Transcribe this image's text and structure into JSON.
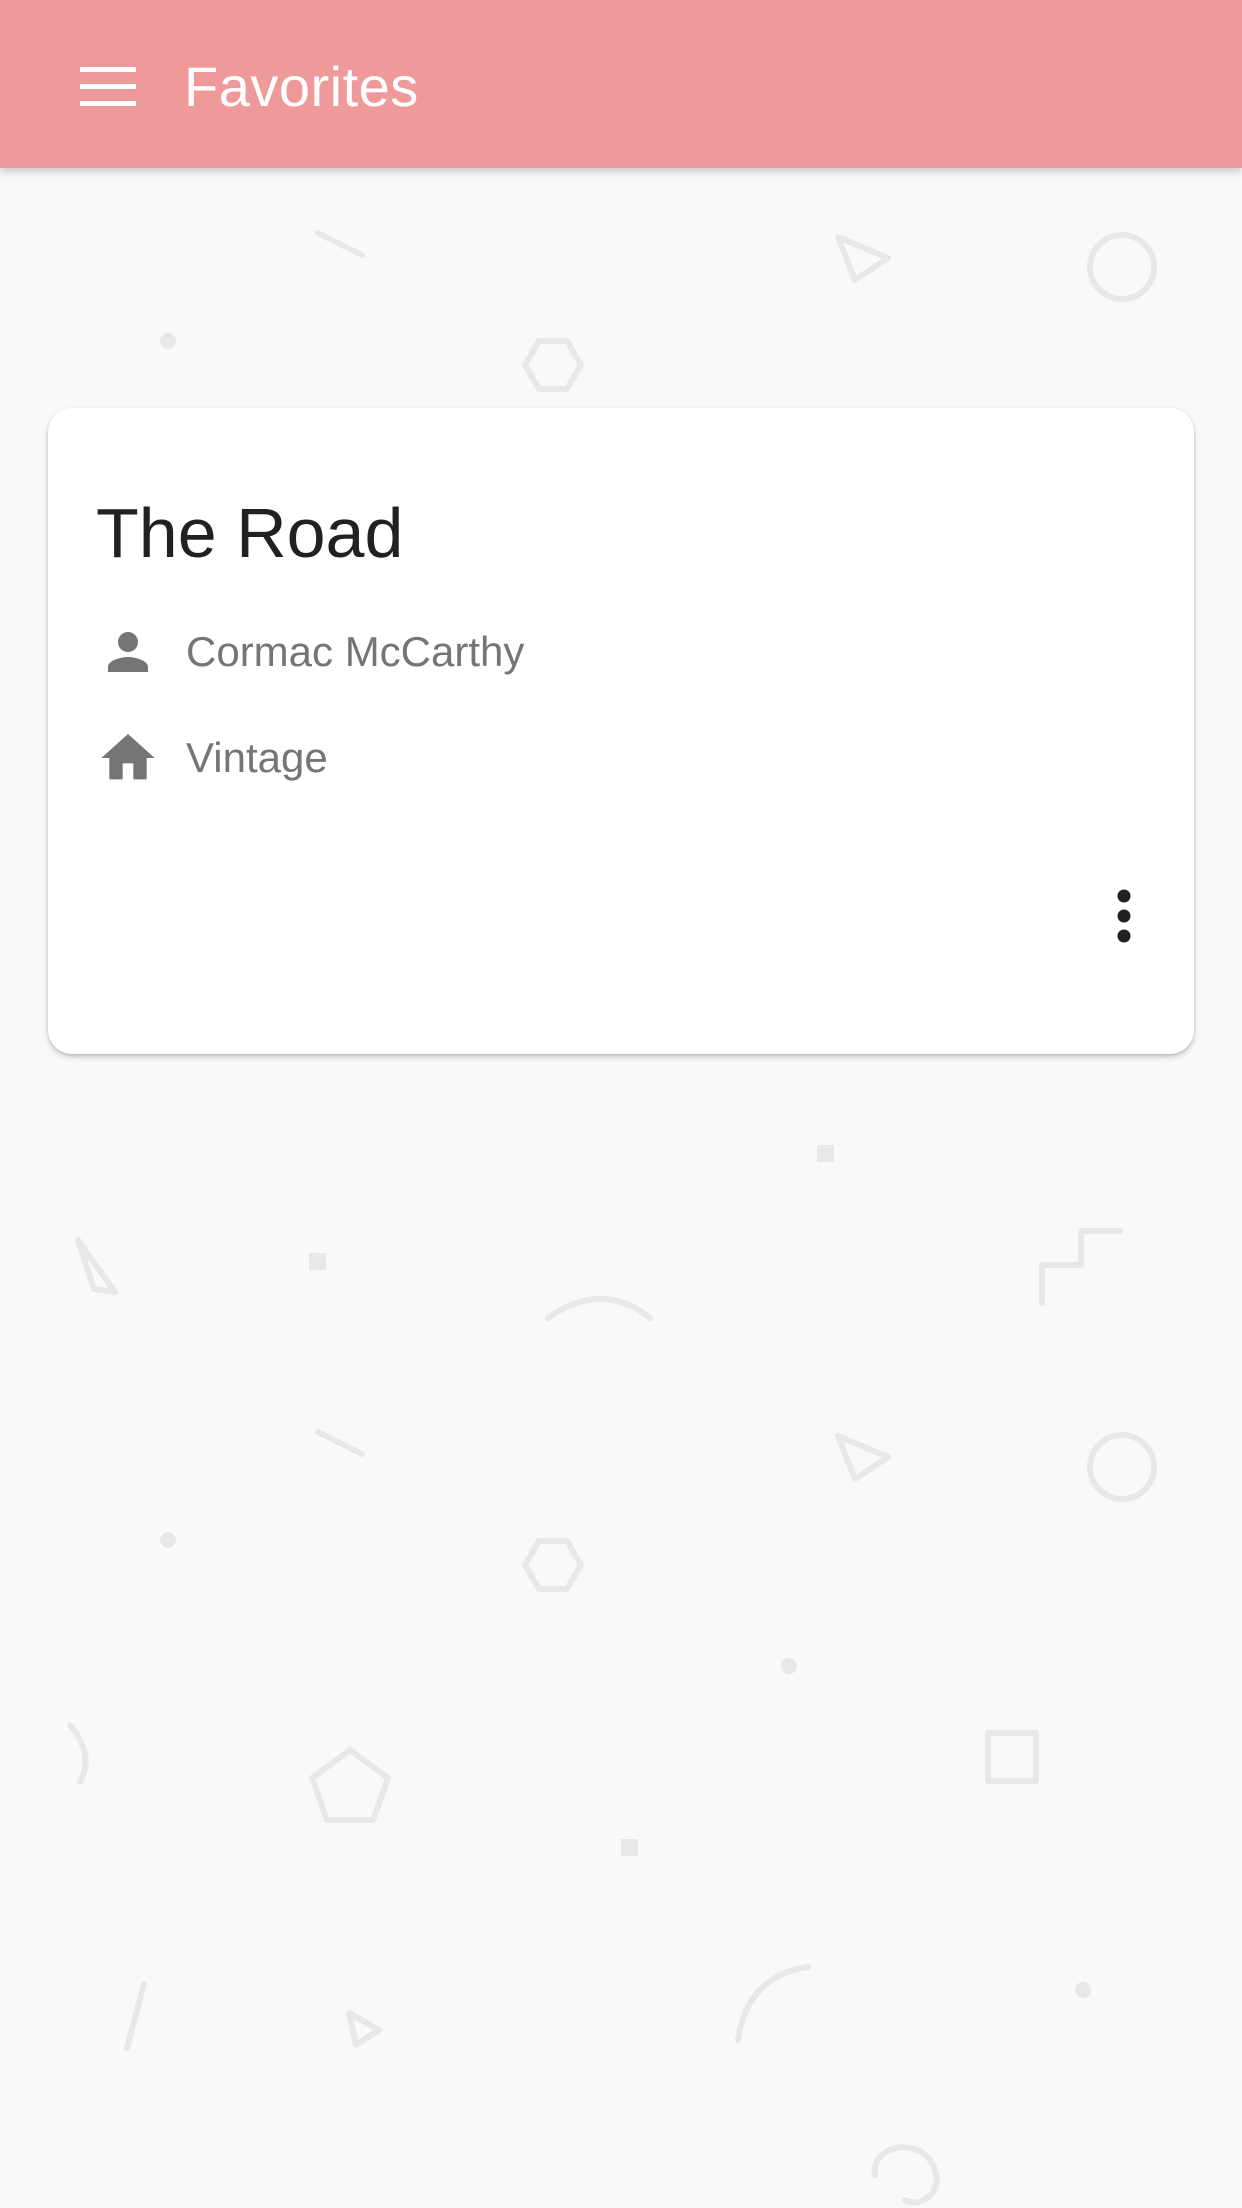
{
  "app_bar": {
    "title": "Favorites",
    "menu_icon": "hamburger-menu-icon",
    "background_color": "#ef9a9a"
  },
  "favorites": [
    {
      "title": "The Road",
      "author": "Cormac McCarthy",
      "author_icon": "person-icon",
      "publisher": "Vintage",
      "publisher_icon": "home-icon",
      "more_icon": "more-vert-icon"
    }
  ]
}
